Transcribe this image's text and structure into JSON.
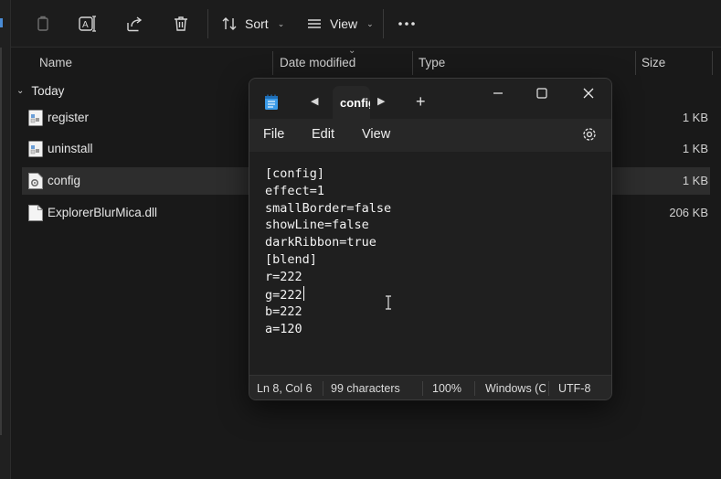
{
  "explorer": {
    "toolbar": {
      "sort_label": "Sort",
      "view_label": "View",
      "icons": [
        "copy-icon",
        "rename-icon",
        "share-icon",
        "delete-icon",
        "more-icon"
      ]
    },
    "columns": {
      "name": "Name",
      "date_modified": "Date modified",
      "type": "Type",
      "size": "Size"
    },
    "group_label": "Today",
    "files": [
      {
        "name": "register",
        "size": "1 KB",
        "icon": "registry-file-icon"
      },
      {
        "name": "uninstall",
        "size": "1 KB",
        "icon": "registry-file-icon"
      },
      {
        "name": "config",
        "size": "1 KB",
        "icon": "settings-file-icon",
        "selected": true
      },
      {
        "name": "ExplorerBlurMica.dll",
        "size": "206 KB",
        "icon": "document-file-icon"
      }
    ]
  },
  "notepad": {
    "tab_label": "config",
    "menu": {
      "file": "File",
      "edit": "Edit",
      "view": "View"
    },
    "content_lines_before_caret": "[config]\neffect=1\nsmallBorder=false\nshowLine=false\ndarkRibbon=true\n[blend]\nr=222\ng=222",
    "content_lines_after_caret": "\nb=222\na=120",
    "status": {
      "position": "Ln 8, Col 6",
      "characters": "99 characters",
      "zoom": "100%",
      "line_ending": "Windows (C",
      "encoding": "UTF-8"
    },
    "accent_color": "#4cc2ff"
  }
}
